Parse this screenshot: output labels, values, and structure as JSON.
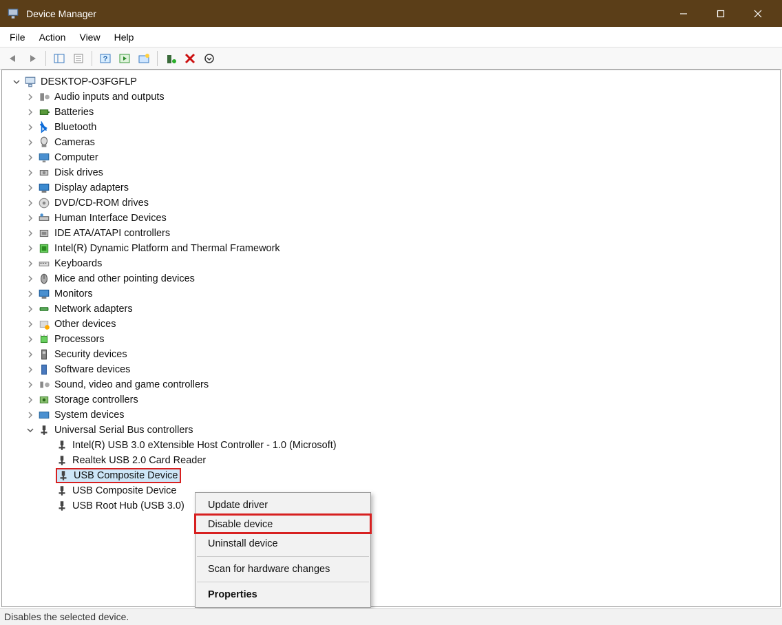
{
  "titlebar": {
    "title": "Device Manager"
  },
  "menus": {
    "file": "File",
    "action": "Action",
    "view": "View",
    "help": "Help"
  },
  "root_node": "DESKTOP-O3FGFLP",
  "categories": [
    "Audio inputs and outputs",
    "Batteries",
    "Bluetooth",
    "Cameras",
    "Computer",
    "Disk drives",
    "Display adapters",
    "DVD/CD-ROM drives",
    "Human Interface Devices",
    "IDE ATA/ATAPI controllers",
    "Intel(R) Dynamic Platform and Thermal Framework",
    "Keyboards",
    "Mice and other pointing devices",
    "Monitors",
    "Network adapters",
    "Other devices",
    "Processors",
    "Security devices",
    "Software devices",
    "Sound, video and game controllers",
    "Storage controllers",
    "System devices",
    "Universal Serial Bus controllers"
  ],
  "usb_children": [
    "Intel(R) USB 3.0 eXtensible Host Controller - 1.0 (Microsoft)",
    "Realtek USB 2.0 Card Reader",
    "USB Composite Device",
    "USB Composite Device",
    "USB Root Hub (USB 3.0)"
  ],
  "selected_index": 2,
  "context_menu": {
    "items": [
      "Update driver",
      "Disable device",
      "Uninstall device",
      "Scan for hardware changes",
      "Properties"
    ],
    "separators_after": [
      2,
      3
    ],
    "bold_index": 4,
    "highlighted_index": 1
  },
  "statusbar": "Disables the selected device."
}
